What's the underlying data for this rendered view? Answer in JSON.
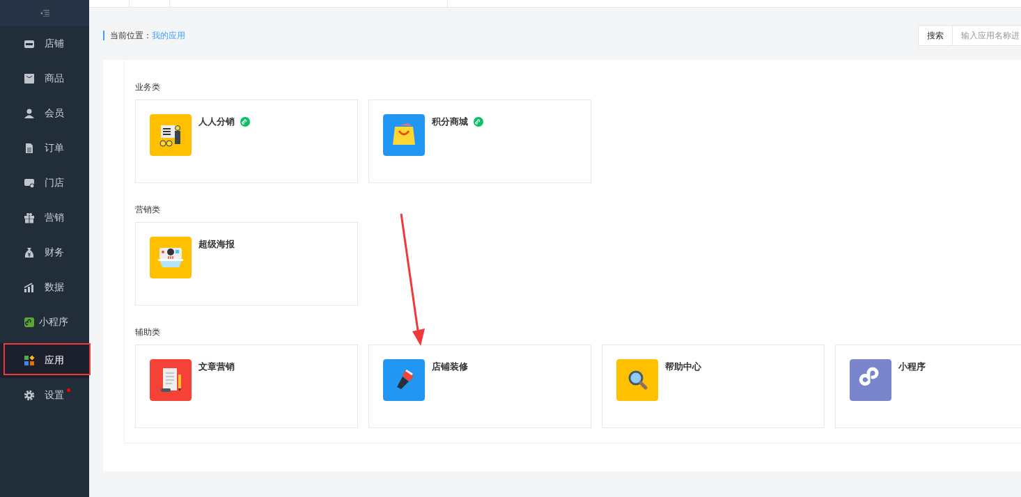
{
  "sidebar": {
    "items": [
      {
        "label": "店铺",
        "selected": false,
        "dot": false
      },
      {
        "label": "商品",
        "selected": false,
        "dot": false
      },
      {
        "label": "会员",
        "selected": false,
        "dot": false
      },
      {
        "label": "订单",
        "selected": false,
        "dot": false
      },
      {
        "label": "门店",
        "selected": false,
        "dot": false
      },
      {
        "label": "营销",
        "selected": false,
        "dot": false
      },
      {
        "label": "财务",
        "selected": false,
        "dot": false
      },
      {
        "label": "数据",
        "selected": false,
        "dot": false
      },
      {
        "label": "小程序",
        "selected": false,
        "dot": false
      },
      {
        "label": "应用",
        "selected": true,
        "dot": false
      },
      {
        "label": "设置",
        "selected": false,
        "dot": true
      }
    ]
  },
  "breadcrumb": {
    "label": "当前位置：",
    "current": "我的应用"
  },
  "search": {
    "button": "搜索",
    "placeholder": "输入应用名称进"
  },
  "sections": [
    {
      "title": "业务类",
      "apps": [
        {
          "name": "人人分销",
          "mini_program": true,
          "color": "#ffc000"
        },
        {
          "name": "积分商城",
          "mini_program": true,
          "color": "#2196f3"
        }
      ]
    },
    {
      "title": "营销类",
      "apps": [
        {
          "name": "超级海报",
          "mini_program": false,
          "color": "#ffc000"
        }
      ]
    },
    {
      "title": "辅助类",
      "apps": [
        {
          "name": "文章营销",
          "mini_program": false,
          "color": "#f44336"
        },
        {
          "name": "店铺装修",
          "mini_program": false,
          "color": "#2196f3"
        },
        {
          "name": "帮助中心",
          "mini_program": false,
          "color": "#ffc000"
        },
        {
          "name": "小程序",
          "mini_program": false,
          "color": "#7986cb"
        }
      ]
    }
  ]
}
